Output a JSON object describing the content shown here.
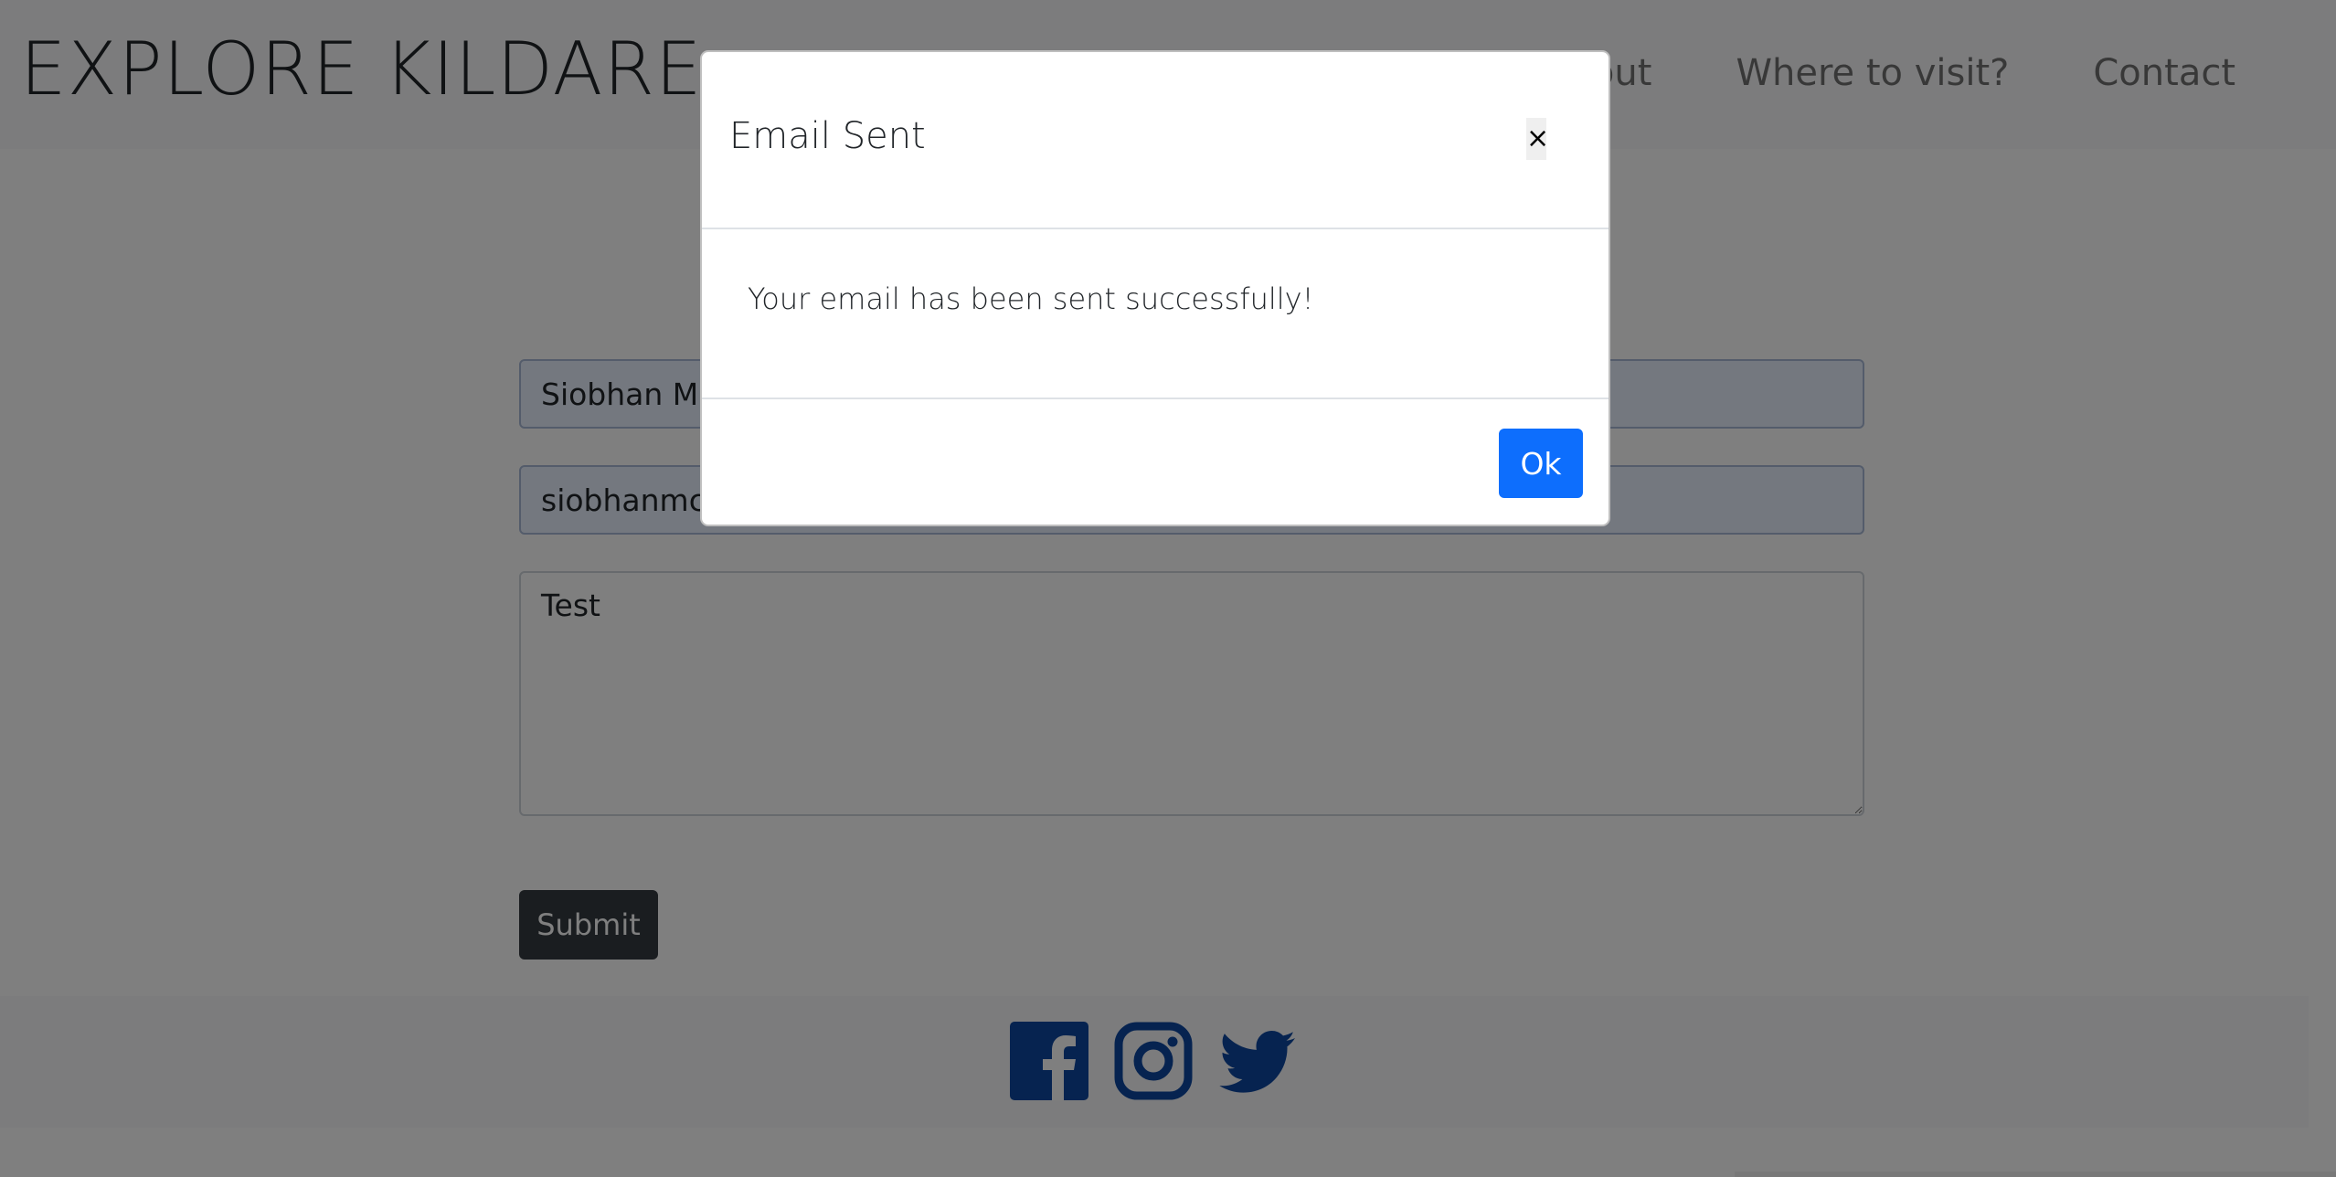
{
  "header": {
    "brand": "EXPLORE KILDARE",
    "nav": [
      {
        "label": "About"
      },
      {
        "label": "Where to visit?"
      },
      {
        "label": "Contact"
      }
    ]
  },
  "form": {
    "name_value": "Siobhan McCarthy",
    "email_value": "siobhanmccarthy@gmail.com",
    "message_value": "Test",
    "submit_label": "Submit"
  },
  "footer": {
    "social": [
      {
        "icon": "facebook-icon"
      },
      {
        "icon": "instagram-icon"
      },
      {
        "icon": "twitter-icon"
      }
    ],
    "icon_color": "#0d47a1"
  },
  "modal": {
    "title": "Email Sent",
    "close_symbol": "×",
    "message": "Your email has been sent successfully!",
    "ok_label": "Ok"
  },
  "colors": {
    "primary": "#0d6efd",
    "dark": "#343a40",
    "backdrop": "rgba(0,0,0,0.5)"
  }
}
